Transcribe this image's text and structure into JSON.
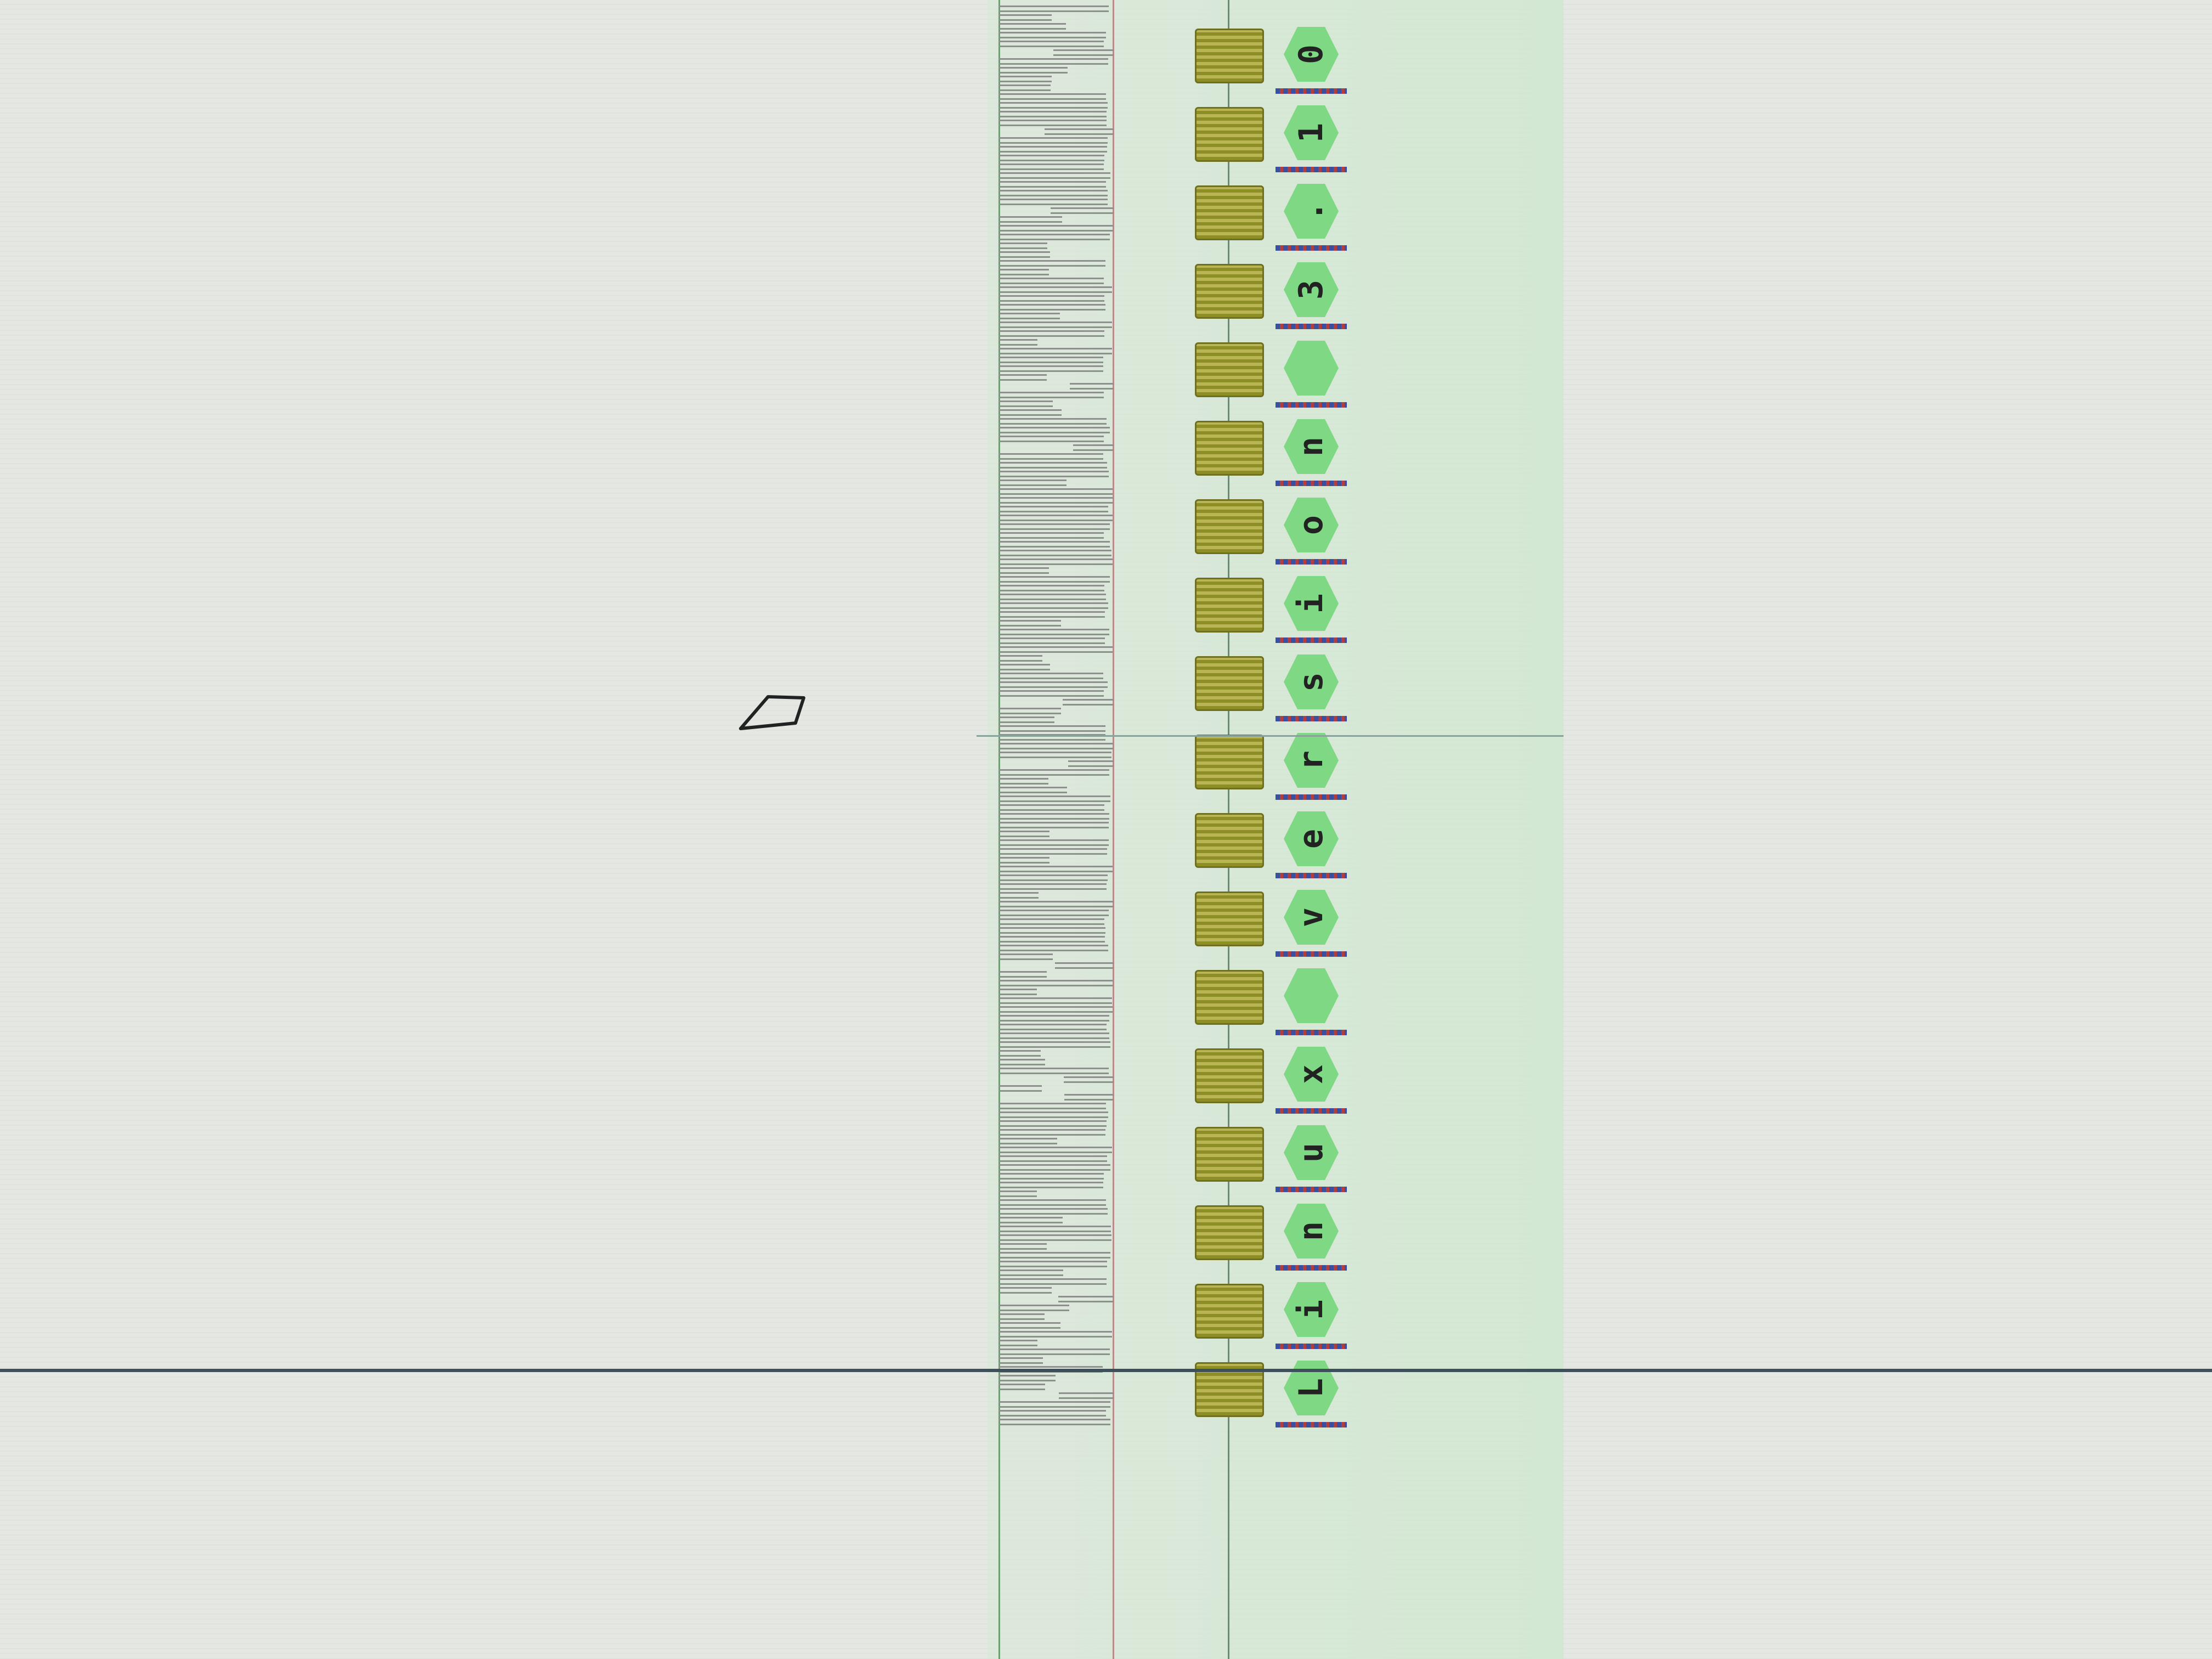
{
  "app": {
    "view": "logic-analyzer-trace"
  },
  "decoded_text": {
    "chars": [
      "L",
      "i",
      "n",
      "u",
      "x",
      " ",
      "v",
      "e",
      "r",
      "s",
      "i",
      "o",
      "n",
      " ",
      "3",
      ".",
      "1",
      "0"
    ]
  },
  "colors": {
    "char_fill": "#7fd884",
    "byte_block": "#8e8e26",
    "cursor_line": "#3c4f5a",
    "trace_area": "#d2e8d2"
  },
  "icons": {
    "mouse_cursor": "mouse-pointer-icon"
  }
}
